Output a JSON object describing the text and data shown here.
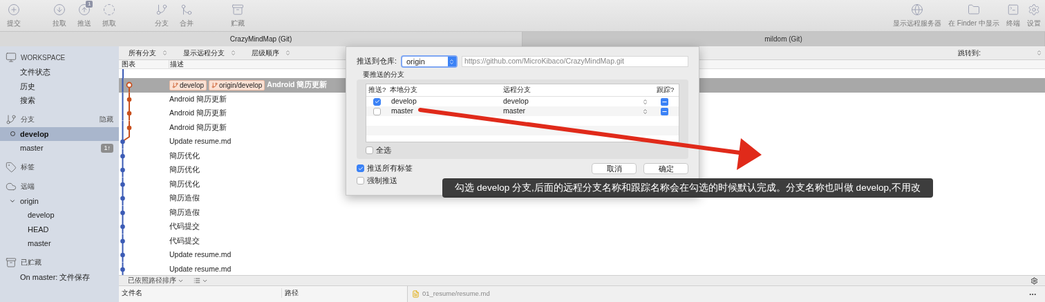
{
  "toolbar": {
    "left": [
      {
        "kind": "commit",
        "label": "提交"
      },
      {
        "kind": "pull",
        "label": "拉取"
      },
      {
        "kind": "push",
        "label": "推送",
        "badge": "1"
      },
      {
        "kind": "fetch",
        "label": "抓取"
      },
      {
        "kind": "branch",
        "label": "分支"
      },
      {
        "kind": "merge",
        "label": "合并"
      },
      {
        "kind": "stash",
        "label": "贮藏"
      }
    ],
    "right": [
      {
        "kind": "remote",
        "label": "显示远程服务器"
      },
      {
        "kind": "finder",
        "label": "在 Finder 中显示"
      },
      {
        "kind": "terminal",
        "label": "终端"
      },
      {
        "kind": "settings",
        "label": "设置"
      }
    ]
  },
  "tabs": [
    {
      "label": "CrazyMindMap (Git)",
      "selected": true
    },
    {
      "label": "mildom (Git)",
      "selected": false
    }
  ],
  "sidebar": [
    {
      "kind": "workspace",
      "title": "WORKSPACE",
      "items": [
        {
          "label": "文件状态",
          "selected": false
        },
        {
          "label": "历史",
          "selected": false
        },
        {
          "label": "搜索",
          "selected": false
        }
      ]
    },
    {
      "kind": "branches",
      "title": "分支",
      "action": "隐藏",
      "items": [
        {
          "label": "develop",
          "selected": true,
          "current": true
        },
        {
          "label": "master",
          "selected": false,
          "current": false,
          "badge": "1↑"
        }
      ]
    },
    {
      "kind": "tags",
      "title": "标签"
    },
    {
      "kind": "remotes",
      "title": "远端",
      "items": [
        {
          "label": "origin",
          "selected": false,
          "expanded": true,
          "children": [
            {
              "label": "develop",
              "selected": false
            },
            {
              "label": "HEAD",
              "selected": false
            },
            {
              "label": "master",
              "selected": false
            }
          ]
        }
      ]
    },
    {
      "kind": "stashes",
      "title": "已贮藏",
      "items": [
        {
          "label": "On master: 文件保存",
          "selected": false
        }
      ]
    }
  ],
  "filters": [
    "所有分支",
    "显示远程分支",
    "层级顺序"
  ],
  "jump": {
    "label": "跳转到:"
  },
  "columns": [
    "图表",
    "描述"
  ],
  "commits": [
    {
      "kind": "tip",
      "refs": [
        "develop",
        "origin/develop"
      ],
      "message": "Android 簡历更新",
      "selected": true
    },
    {
      "kind": "side",
      "message": "Android 簡历更新",
      "selected": false
    },
    {
      "kind": "side",
      "message": "Android 簡历更新",
      "selected": false
    },
    {
      "kind": "side",
      "message": "Android 簡历更新",
      "selected": false
    },
    {
      "kind": "main",
      "message": "Update resume.md",
      "selected": false
    },
    {
      "kind": "main",
      "message": "簡历优化",
      "selected": false
    },
    {
      "kind": "main",
      "message": "簡历优化",
      "selected": false
    },
    {
      "kind": "main",
      "message": "簡历优化",
      "selected": false
    },
    {
      "kind": "main",
      "message": "簡历造假",
      "selected": false
    },
    {
      "kind": "main",
      "message": "簡历造假",
      "selected": false
    },
    {
      "kind": "main",
      "message": "代码提交",
      "selected": false
    },
    {
      "kind": "main",
      "message": "代码提交",
      "selected": false
    },
    {
      "kind": "main",
      "message": "Update resume.md",
      "selected": false
    },
    {
      "kind": "main",
      "message": "Update resume.md",
      "selected": false
    }
  ],
  "file_bar": {
    "sort": "已依照路径排序",
    "columns": [
      "文件名",
      "路径"
    ],
    "open_file": "01_resume/resume.md"
  },
  "dialog": {
    "remote_label": "推送到仓库:",
    "remote": "origin",
    "url": "https://github.com/MicroKibaco/CrazyMindMap.git",
    "section": "要推送的分支",
    "columns": [
      "推送?",
      "本地分支",
      "远程分支",
      "跟踪?"
    ],
    "rows": [
      {
        "checked": true,
        "local": "develop",
        "remote": "develop",
        "tracking": true
      },
      {
        "checked": false,
        "local": "master",
        "remote": "master",
        "tracking": true
      }
    ],
    "select_all": {
      "label": "全选",
      "checked": false
    },
    "options": [
      {
        "label": "推送所有标签",
        "checked": true
      },
      {
        "label": "强制推送",
        "checked": false
      }
    ],
    "buttons": [
      "取消",
      "确定"
    ]
  },
  "tooltip": "勾选 develop 分支,后面的远程分支名称和跟踪名称会在勾选的时候默认完成。分支名称也叫做 develop,不用改"
}
